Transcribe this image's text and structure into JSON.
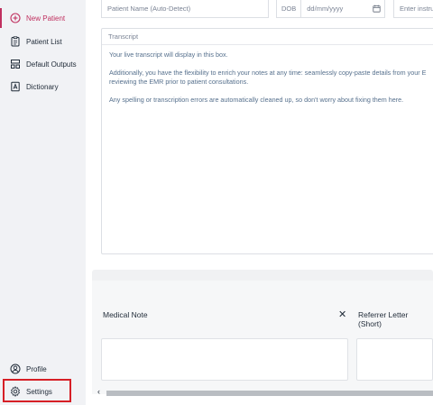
{
  "sidebar": {
    "items": [
      {
        "label": "New Patient",
        "icon": "plus-circle-icon",
        "active": true
      },
      {
        "label": "Patient List",
        "icon": "clipboard-icon",
        "active": false
      },
      {
        "label": "Default Outputs",
        "icon": "layout-icon",
        "active": false
      },
      {
        "label": "Dictionary",
        "icon": "book-icon",
        "active": false
      }
    ],
    "bottom": [
      {
        "label": "Profile",
        "icon": "user-circle-icon"
      },
      {
        "label": "Settings",
        "icon": "gear-icon"
      }
    ]
  },
  "header": {
    "patient_name_placeholder": "Patient Name (Auto-Detect)",
    "dob_label": "DOB",
    "dob_placeholder": "dd/mm/yyyy",
    "instructions_placeholder": "Enter instru"
  },
  "transcript": {
    "label": "Transcript",
    "lines": [
      "Your live transcript will display in this box.",
      "Additionally, you have the flexibility to enrich your notes at any time: seamlessly copy-paste details from your E",
      "reviewing the EMR prior to patient consultations.",
      "Any spelling or transcription errors are automatically cleaned up, so don't worry about fixing them here."
    ]
  },
  "outputs": {
    "cards": [
      {
        "title": "Medical Note"
      },
      {
        "title": "Referrer Letter (Short)"
      }
    ],
    "close_glyph": "✕",
    "scroll_left_glyph": "‹"
  },
  "colors": {
    "accent": "#c0305f",
    "highlight": "#d61f26"
  }
}
